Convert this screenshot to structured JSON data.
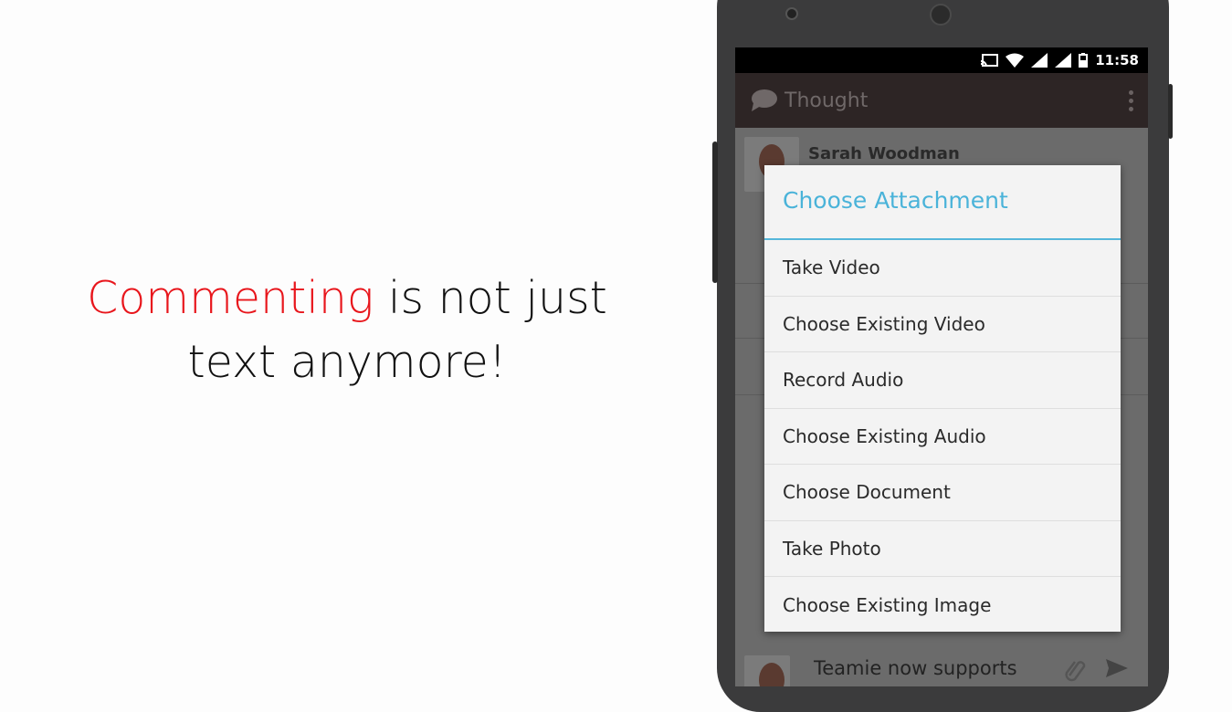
{
  "headline": {
    "highlight": "Commenting",
    "rest": " is not just",
    "line2": "text anymore!"
  },
  "status_bar": {
    "time": "11:58",
    "icons": [
      "cast-icon",
      "wifi-icon",
      "signal-icon",
      "signal-icon",
      "battery-icon"
    ]
  },
  "app_bar": {
    "title": "Thought",
    "icon": "speech-bubble-icon",
    "menu_icon": "overflow-menu-icon"
  },
  "post": {
    "author": "Sarah Woodman"
  },
  "dialog": {
    "title": "Choose Attachment",
    "items": [
      "Take Video",
      "Choose Existing Video",
      "Record Audio",
      "Choose Existing Audio",
      "Choose Document",
      "Take Photo",
      "Choose Existing Image"
    ]
  },
  "composer": {
    "text": "Teamie now supports",
    "attach_icon": "paperclip-icon",
    "send_icon": "send-icon"
  },
  "colors": {
    "accent": "#4ab3d9",
    "highlight": "#e8161c",
    "app_bar": "#2d2525"
  }
}
